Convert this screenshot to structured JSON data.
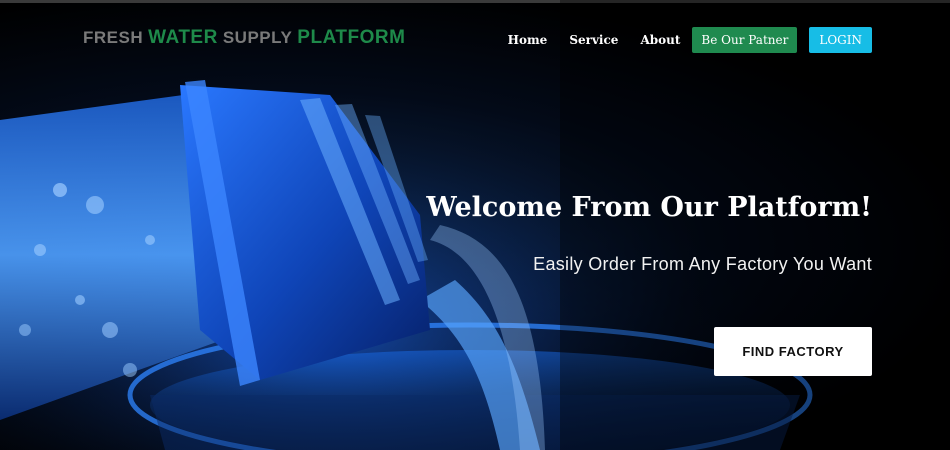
{
  "brand": {
    "word1": "FRESH",
    "word2": "WATER",
    "word3": "SUPPLY",
    "word4": "PLATFORM"
  },
  "nav": {
    "home": "Home",
    "service": "Service",
    "about": "About",
    "partner": "Be Our Patner",
    "login": "LOGIN"
  },
  "hero": {
    "title": "Welcome From Our Platform!",
    "subtitle": "Easily Order From Any Factory You Want",
    "cta": "FIND FACTORY"
  },
  "colors": {
    "brand_green": "#1e8a4a",
    "partner_button": "#1f8a4f",
    "login_button": "#17bde6",
    "water_blue": "#1f6fe0"
  },
  "icons": {
    "hero_image": "water-bottle-pouring-into-glass"
  }
}
